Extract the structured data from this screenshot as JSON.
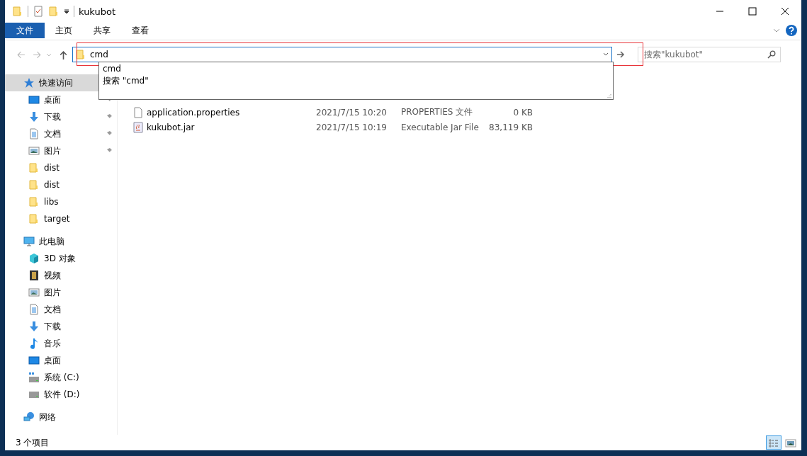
{
  "window": {
    "title": "kukubot"
  },
  "ribbon_tabs": [
    {
      "label": "文件",
      "kind": "file"
    },
    {
      "label": "主页",
      "kind": "tab"
    },
    {
      "label": "共享",
      "kind": "tab"
    },
    {
      "label": "查看",
      "kind": "tab"
    }
  ],
  "address_bar": {
    "value": "cmd",
    "highlighted": true,
    "suggestions": [
      "cmd",
      "搜索 \"cmd\""
    ]
  },
  "search": {
    "placeholder": "搜索\"kukubot\""
  },
  "navigation": [
    {
      "label": "快速访问",
      "kind": "star",
      "selected": true,
      "children": [
        {
          "label": "桌面",
          "kind": "desktop",
          "pinned": true
        },
        {
          "label": "下载",
          "kind": "download",
          "pinned": true
        },
        {
          "label": "文档",
          "kind": "document",
          "pinned": true
        },
        {
          "label": "图片",
          "kind": "pictures",
          "pinned": true
        },
        {
          "label": "dist",
          "kind": "folder",
          "pinned": false
        },
        {
          "label": "dist",
          "kind": "folder",
          "pinned": false
        },
        {
          "label": "libs",
          "kind": "folder",
          "pinned": false
        },
        {
          "label": "target",
          "kind": "folder",
          "pinned": false
        }
      ]
    },
    {
      "label": "此电脑",
      "kind": "computer",
      "selected": false,
      "children": [
        {
          "label": "3D 对象",
          "kind": "cube"
        },
        {
          "label": "视频",
          "kind": "video"
        },
        {
          "label": "图片",
          "kind": "pictures"
        },
        {
          "label": "文档",
          "kind": "document"
        },
        {
          "label": "下载",
          "kind": "download"
        },
        {
          "label": "音乐",
          "kind": "music"
        },
        {
          "label": "桌面",
          "kind": "desktop"
        },
        {
          "label": "系统 (C:)",
          "kind": "system-drive"
        },
        {
          "label": "软件 (D:)",
          "kind": "drive"
        }
      ]
    },
    {
      "label": "网络",
      "kind": "network",
      "selected": false
    }
  ],
  "files": [
    {
      "name": "application.properties",
      "date": "2021/7/15 10:20",
      "type": "PROPERTIES 文件",
      "size": "0 KB",
      "kind": "file"
    },
    {
      "name": "kukubot.jar",
      "date": "2021/7/15 10:19",
      "type": "Executable Jar File",
      "size": "83,119 KB",
      "kind": "jar"
    }
  ],
  "status_bar": {
    "count": "3 个项目",
    "views": [
      {
        "kind": "details",
        "selected": true
      },
      {
        "kind": "thumbnails",
        "selected": false
      }
    ]
  }
}
